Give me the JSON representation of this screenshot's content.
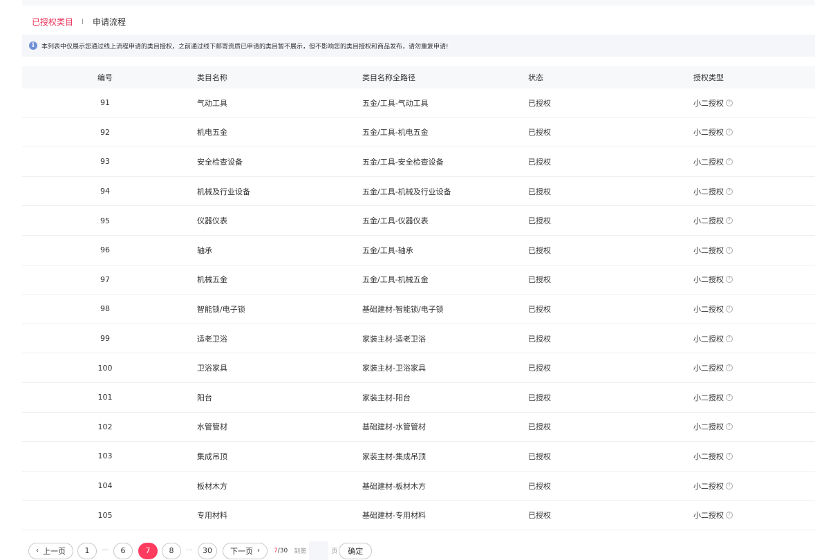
{
  "tabs": {
    "authorized": "已授权类目",
    "process": "申请流程"
  },
  "notice": {
    "icon": "info-icon",
    "text": "本列表中仅展示您通过线上流程申请的类目授权，之前通过线下邮寄资质已申请的类目暂不展示，但不影响您的类目授权和商品发布，请勿重复申请!"
  },
  "table": {
    "headers": {
      "num": "编号",
      "name": "类目名称",
      "path": "类目名称全路径",
      "status": "状态",
      "auth": "授权类型"
    },
    "rows": [
      {
        "num": "91",
        "name": "气动工具",
        "path": "五金/工具-气动工具",
        "status": "已授权",
        "auth": "小二授权"
      },
      {
        "num": "92",
        "name": "机电五金",
        "path": "五金/工具-机电五金",
        "status": "已授权",
        "auth": "小二授权"
      },
      {
        "num": "93",
        "name": "安全检查设备",
        "path": "五金/工具-安全检查设备",
        "status": "已授权",
        "auth": "小二授权"
      },
      {
        "num": "94",
        "name": "机械及行业设备",
        "path": "五金/工具-机械及行业设备",
        "status": "已授权",
        "auth": "小二授权"
      },
      {
        "num": "95",
        "name": "仪器仪表",
        "path": "五金/工具-仪器仪表",
        "status": "已授权",
        "auth": "小二授权"
      },
      {
        "num": "96",
        "name": "轴承",
        "path": "五金/工具-轴承",
        "status": "已授权",
        "auth": "小二授权"
      },
      {
        "num": "97",
        "name": "机械五金",
        "path": "五金/工具-机械五金",
        "status": "已授权",
        "auth": "小二授权"
      },
      {
        "num": "98",
        "name": "智能锁/电子锁",
        "path": "基础建材-智能锁/电子锁",
        "status": "已授权",
        "auth": "小二授权"
      },
      {
        "num": "99",
        "name": "适老卫浴",
        "path": "家装主材-适老卫浴",
        "status": "已授权",
        "auth": "小二授权"
      },
      {
        "num": "100",
        "name": "卫浴家具",
        "path": "家装主材-卫浴家具",
        "status": "已授权",
        "auth": "小二授权"
      },
      {
        "num": "101",
        "name": "阳台",
        "path": "家装主材-阳台",
        "status": "已授权",
        "auth": "小二授权"
      },
      {
        "num": "102",
        "name": "水管管材",
        "path": "基础建材-水管管材",
        "status": "已授权",
        "auth": "小二授权"
      },
      {
        "num": "103",
        "name": "集成吊顶",
        "path": "家装主材-集成吊顶",
        "status": "已授权",
        "auth": "小二授权"
      },
      {
        "num": "104",
        "name": "板材木方",
        "path": "基础建材-板材木方",
        "status": "已授权",
        "auth": "小二授权"
      },
      {
        "num": "105",
        "name": "专用材料",
        "path": "基础建材-专用材料",
        "status": "已授权",
        "auth": "小二授权"
      }
    ],
    "help_icon": "question-circle-icon",
    "help_glyph": "?"
  },
  "pagination": {
    "prev_arrow": "‹",
    "prev_label": "上一页",
    "page_first": "1",
    "ellipsis": "···",
    "page_a": "6",
    "page_current": "7",
    "page_b": "8",
    "page_last": "30",
    "next_label": "下一页",
    "next_arrow": "›",
    "current": "7",
    "total": "/30",
    "goto_label": "到第",
    "goto_value": "",
    "page_suffix": "页",
    "confirm_label": "确定"
  },
  "colors": {
    "accent": "#ff3c5f",
    "tab_active": "#e8335a",
    "info": "#6f8fd6"
  }
}
